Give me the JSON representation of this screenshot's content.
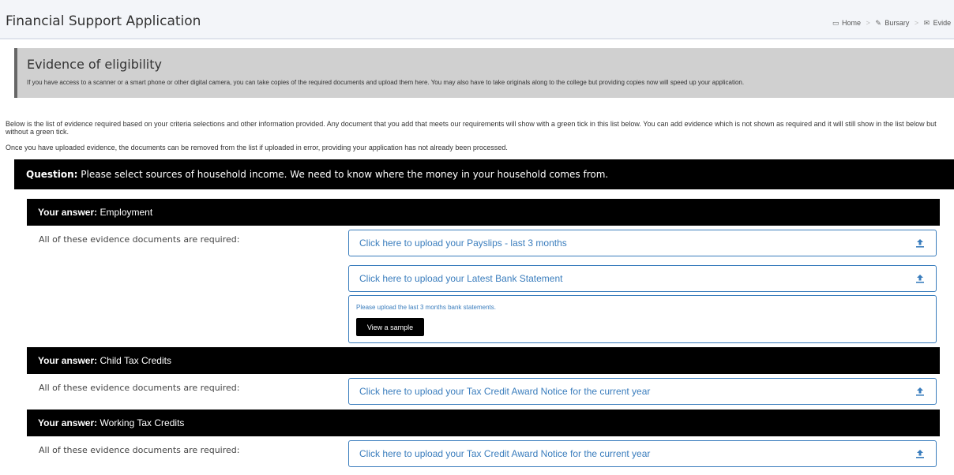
{
  "header": {
    "title": "Financial Support Application",
    "breadcrumbs": [
      {
        "icon": "laptop-icon",
        "label": "Home"
      },
      {
        "icon": "edit-icon",
        "label": "Bursary"
      },
      {
        "icon": "envelope-icon",
        "label": "Evide"
      }
    ],
    "separator": ">"
  },
  "evidence": {
    "title": "Evidence of eligibility",
    "description": "If you have access to a scanner or a smart phone or other digital camera, you can take copies of the required documents and upload them here.  You may also have to take originals along to the college but providing copies now will speed up your application."
  },
  "intro": {
    "line1": "Below is the list of evidence required based on your criteria selections and other information provided. Any document that you add that meets our requirements will show with a green tick in this list below. You can add evidence which is not shown as required and it will still show in the list below but without a green tick.",
    "line2": "Once you have uploaded evidence, the documents can be removed from the list if uploaded in error, providing your application has not already been processed."
  },
  "question": {
    "prefix": "Question:",
    "text": " Please select sources of household income. We need to know where the money in your household comes from."
  },
  "answers": [
    {
      "prefix": "Your answer:",
      "value": " Employment",
      "required_text": "All of these evidence documents are required:",
      "uploads": [
        "Click here to upload your Payslips - last 3 months",
        "Click here to upload your Latest Bank Statement"
      ],
      "note": "Please upload the last 3 months bank statements.",
      "sample_button": "View a sample"
    },
    {
      "prefix": "Your answer:",
      "value": " Child Tax Credits",
      "required_text": "All of these evidence documents are required:",
      "uploads": [
        "Click here to upload your Tax Credit Award Notice for the current year"
      ]
    },
    {
      "prefix": "Your answer:",
      "value": " Working Tax Credits",
      "required_text": "All of these evidence documents are required:",
      "uploads": [
        "Click here to upload your Tax Credit Award Notice for the current year"
      ]
    }
  ],
  "colors": {
    "accent": "#3a7dbd",
    "bar": "#000000",
    "panel": "#d0d0d0"
  },
  "icons": {
    "upload": "upload-icon"
  }
}
